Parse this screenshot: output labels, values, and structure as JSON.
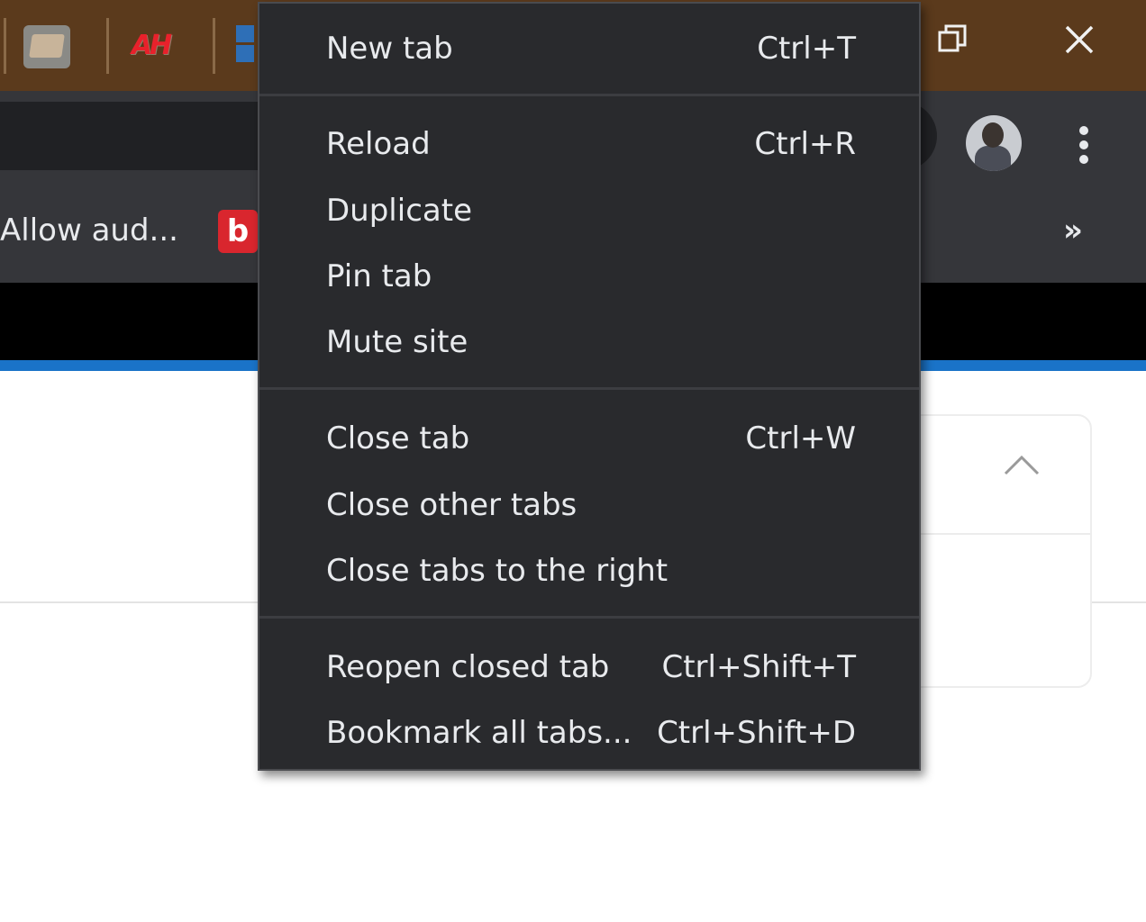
{
  "browser": {
    "bookmarks_bar": {
      "item_label": "Allow aud...",
      "b_icon_letter": "b",
      "more_glyph": "»"
    },
    "favicons": [
      "screen-favicon",
      "ah-favicon",
      "windows-favicon"
    ],
    "colors": {
      "tabstrip": "#5b3a1c",
      "toolbar": "#35363a",
      "menu_bg": "#292a2d",
      "menu_text": "#e8eaed",
      "page_accent": "#1a73c8"
    }
  },
  "context_menu": {
    "groups": [
      [
        {
          "label": "New tab",
          "shortcut": "Ctrl+T"
        }
      ],
      [
        {
          "label": "Reload",
          "shortcut": "Ctrl+R"
        },
        {
          "label": "Duplicate",
          "shortcut": ""
        },
        {
          "label": "Pin tab",
          "shortcut": ""
        },
        {
          "label": "Mute site",
          "shortcut": ""
        }
      ],
      [
        {
          "label": "Close tab",
          "shortcut": "Ctrl+W"
        },
        {
          "label": "Close other tabs",
          "shortcut": ""
        },
        {
          "label": "Close tabs to the right",
          "shortcut": ""
        }
      ],
      [
        {
          "label": "Reopen closed tab",
          "shortcut": "Ctrl+Shift+T"
        },
        {
          "label": "Bookmark all tabs...",
          "shortcut": "Ctrl+Shift+D"
        }
      ]
    ]
  }
}
